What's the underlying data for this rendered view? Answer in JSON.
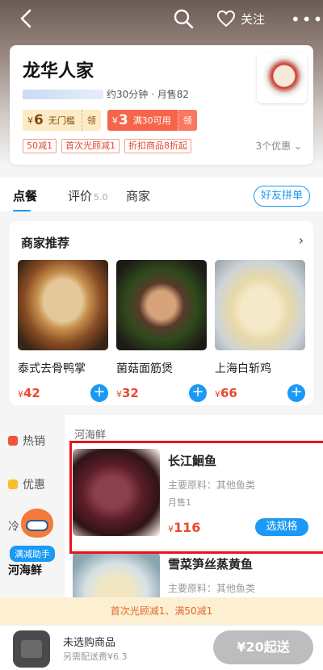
{
  "header": {
    "follow_label": "关注"
  },
  "shop": {
    "name": "龙华人家",
    "delivery_meta": "约30分钟 · 月售82",
    "coupons": [
      {
        "currency": "¥",
        "amount": "6",
        "desc": "无门槛",
        "action": "领"
      },
      {
        "currency": "¥",
        "amount": "3",
        "desc": "满30可用",
        "action": "领"
      }
    ],
    "promos": [
      "50减1",
      "首次光顾减1",
      "折扣商品8折起"
    ],
    "promo_more": "3个优惠 ⌄"
  },
  "tabs": {
    "order": "点餐",
    "review": "评价",
    "review_score": "5.0",
    "merchant": "商家",
    "group_button": "好友拼单"
  },
  "recommend": {
    "title": "商家推荐",
    "items": [
      {
        "name": "泰式去骨鸭掌",
        "currency": "¥",
        "price": "42"
      },
      {
        "name": "菌菇面筋煲",
        "currency": "¥",
        "price": "32"
      },
      {
        "name": "上海白斩鸡",
        "currency": "¥",
        "price": "66"
      }
    ]
  },
  "menu": {
    "categories": [
      "热销",
      "优惠",
      "冷",
      "河海鲜"
    ],
    "mascot_label": "满减助手",
    "section_title": "河海鲜",
    "dish": {
      "name": "长江鮰鱼",
      "ingredients": "主要原料：其他鱼类",
      "sold": "月售1",
      "currency": "¥",
      "price": "116",
      "action": "选规格"
    },
    "dish2": {
      "name": "雪菜笋丝蒸黄鱼",
      "ingredients": "主要原料：其他鱼类"
    }
  },
  "discount_strip": "首次光顾减1、满50减1",
  "cart": {
    "empty_label": "未选购商品",
    "delivery_fee": "另需配送费¥6.3",
    "checkout_label": "¥20起送"
  },
  "colors": {
    "accent": "#1a99f5",
    "price": "#e94a2e",
    "highlight": "#e8141e"
  }
}
